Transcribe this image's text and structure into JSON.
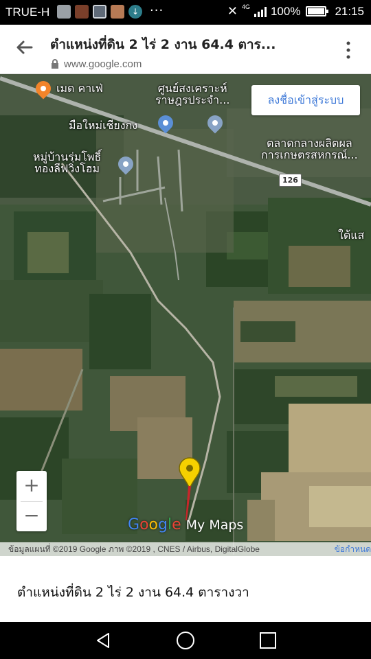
{
  "status_bar": {
    "carrier": "TRUE-H",
    "more_indicator": "···",
    "network_type": "4G",
    "battery": "100%",
    "time": "21:15"
  },
  "app_bar": {
    "back_icon": "back-arrow-icon",
    "title": "ตำแหน่งที่ดิน 2 ไร่ 2 งาน 64.4 ตาร...",
    "url": "www.google.com",
    "menu_icon": "overflow-menu-icon"
  },
  "map": {
    "sign_in_button": "ลงชื่อเข้าสู่ระบบ",
    "places": [
      {
        "name": "เมด คาเฟ่"
      },
      {
        "name": "ศูนย์สงเคราะห์\nราษฎรประจำ..."
      },
      {
        "name": "มือใหม่เชียงกง"
      },
      {
        "name": "หมู่บ้านร่มโพธิ์\nทองลีฟวิ่งโฮม"
      },
      {
        "name": "ตลาดกลางผลิตผล\nการเกษตรสหกรณ์..."
      },
      {
        "name": "ใต้แส"
      }
    ],
    "road_number": "126",
    "zoom_in": "+",
    "zoom_out": "−",
    "brand_google": [
      "G",
      "o",
      "o",
      "g",
      "l",
      "e"
    ],
    "brand_mymaps": "My Maps",
    "attribution": "ข้อมูลแผนที่ ©2019 Google ภาพ ©2019 , CNES / Airbus, DigitalGlobe",
    "terms": "ข้อกำหนด",
    "marker_color": "#f5d000"
  },
  "panel": {
    "title": "ตำแหน่งที่ดิน 2 ไร่ 2 งาน 64.4 ตารางวา"
  }
}
